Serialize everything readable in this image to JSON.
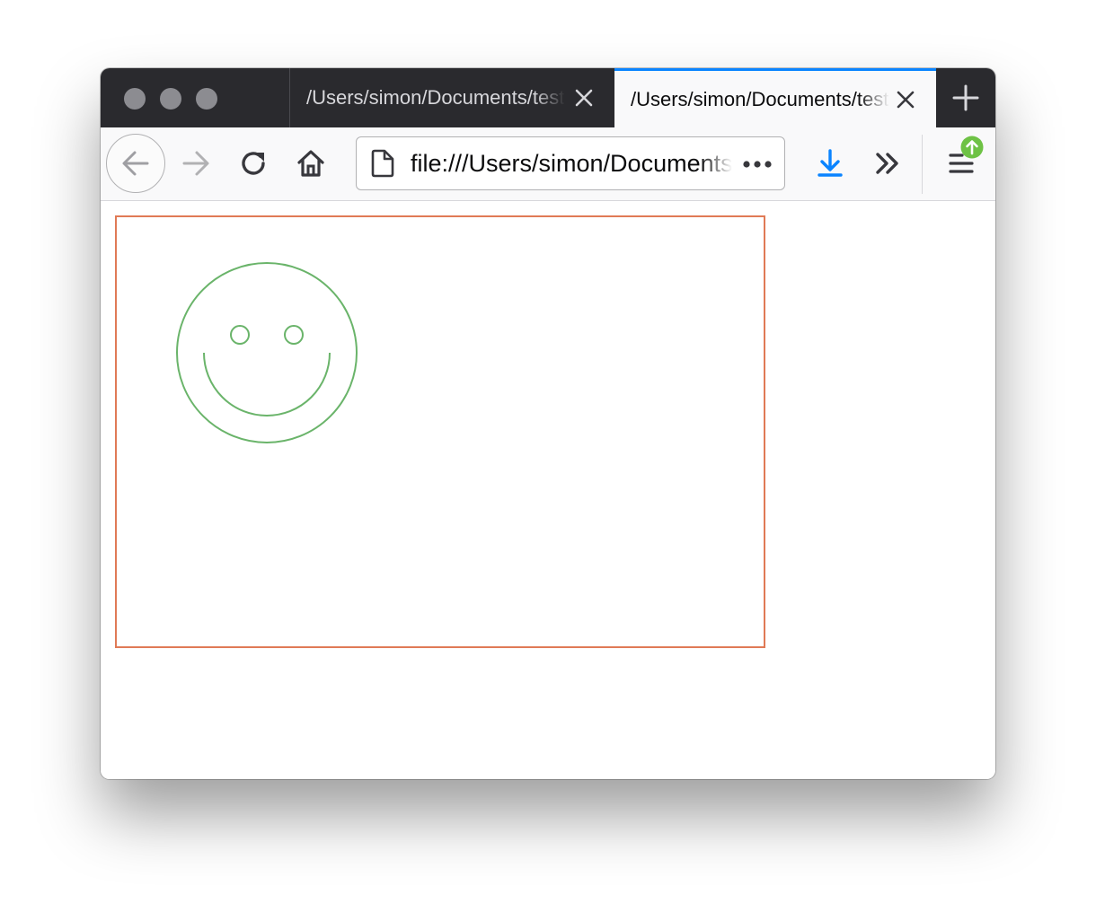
{
  "window": {
    "traffic_lights": [
      "close",
      "minimize",
      "zoom"
    ]
  },
  "tabs": [
    {
      "title": "/Users/simon/Documents/test.html",
      "active": false
    },
    {
      "title": "/Users/simon/Documents/test.html",
      "active": true
    }
  ],
  "toolbar": {
    "back_icon": "back-arrow-icon",
    "forward_icon": "forward-arrow-icon",
    "reload_icon": "reload-icon",
    "home_icon": "home-icon",
    "url": "file:///Users/simon/Documents/test.html",
    "page_actions_icon": "ellipsis-icon",
    "downloads_icon": "download-icon",
    "overflow_icon": "double-chevron-icon",
    "menu_icon": "hamburger-icon",
    "update_badge_icon": "update-arrow-icon"
  },
  "colors": {
    "accent": "#0a84ff",
    "download_blue": "#0a84ff",
    "update_green": "#6ec245",
    "canvas_border": "#e07a56",
    "smiley_stroke": "#6ab46a"
  },
  "content": {
    "drawing": "smiley-face"
  }
}
